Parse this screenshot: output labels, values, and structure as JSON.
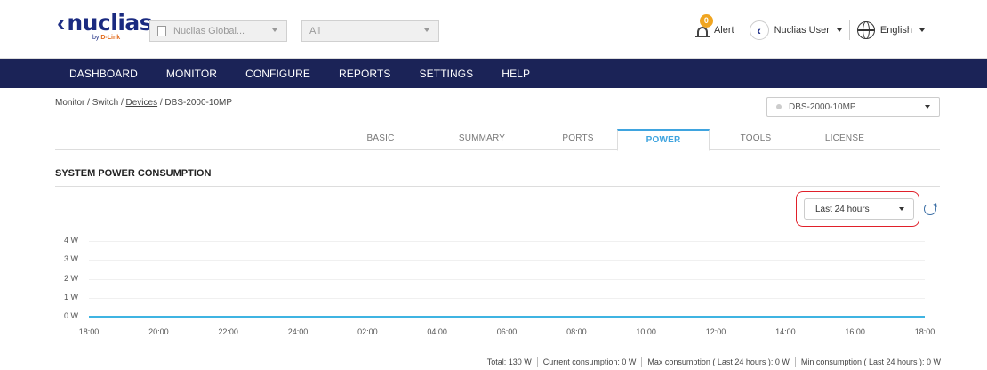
{
  "header": {
    "logo_text": "nuclias",
    "logo_sub_prefix": "by ",
    "logo_sub_brand": "D-Link",
    "org_select": {
      "value": "Nuclias Global..."
    },
    "site_select": {
      "value": "All"
    },
    "alert_count": "0",
    "alert_label": "Alert",
    "user_label": "Nuclias User",
    "language_label": "English"
  },
  "nav": {
    "items": [
      "DASHBOARD",
      "MONITOR",
      "CONFIGURE",
      "REPORTS",
      "SETTINGS",
      "HELP"
    ]
  },
  "breadcrumb": {
    "monitor": "Monitor",
    "switch": "Switch",
    "devices": "Devices",
    "device": "DBS-2000-10MP",
    "separator": "/"
  },
  "device_select": {
    "value": "DBS-2000-10MP"
  },
  "tabs": {
    "items": [
      "BASIC",
      "SUMMARY",
      "PORTS",
      "POWER",
      "TOOLS",
      "LICENSE"
    ],
    "active": "POWER"
  },
  "section": {
    "title": "SYSTEM POWER CONSUMPTION"
  },
  "range_select": {
    "value": "Last 24 hours"
  },
  "chart_data": {
    "type": "line",
    "title": "",
    "xlabel": "",
    "ylabel": "",
    "y_ticks": [
      "4 W",
      "3 W",
      "2 W",
      "1 W",
      "0 W"
    ],
    "x_ticks": [
      "18:00",
      "20:00",
      "22:00",
      "24:00",
      "02:00",
      "04:00",
      "06:00",
      "08:00",
      "10:00",
      "12:00",
      "14:00",
      "16:00",
      "18:00"
    ],
    "ylim": [
      0,
      4
    ],
    "series": [
      {
        "values": [
          0,
          0,
          0,
          0,
          0,
          0,
          0,
          0,
          0,
          0,
          0,
          0,
          0
        ]
      }
    ],
    "line_color": "#3fb4e2",
    "grid": true
  },
  "footer": {
    "total": "Total: 130 W",
    "current": "Current consumption: 0 W",
    "max": "Max consumption ( Last 24 hours ): 0 W",
    "min": "Min consumption ( Last 24 hours ): 0 W"
  },
  "colors": {
    "nav_bg": "#1b2357",
    "accent": "#3fa4df",
    "highlight": "#e0202a",
    "badge": "#f0a520"
  }
}
